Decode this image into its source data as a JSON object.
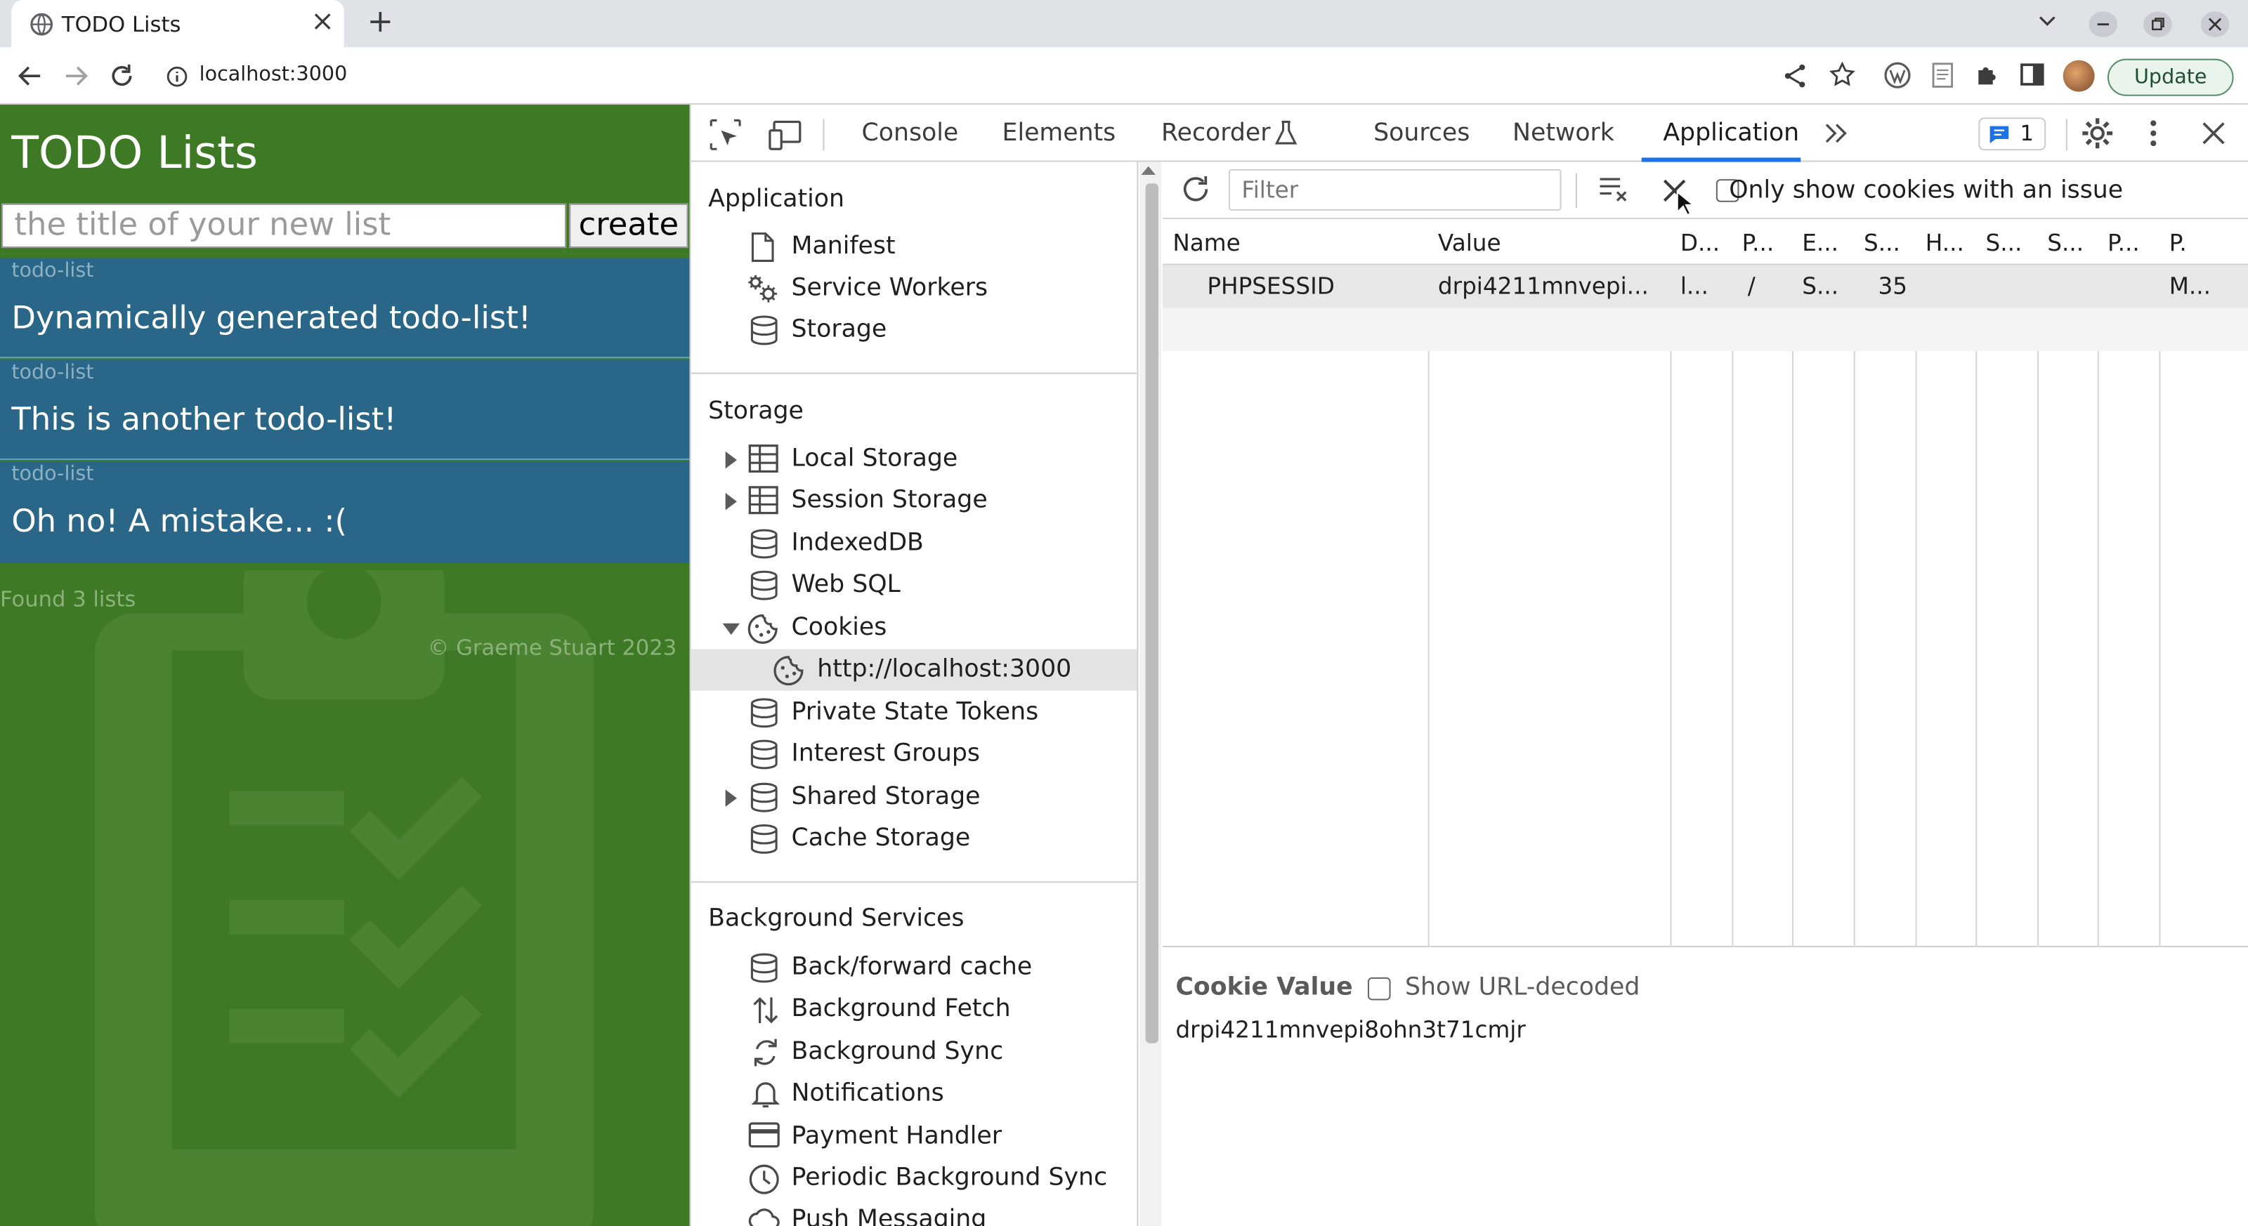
{
  "browser": {
    "tab_title": "TODO Lists",
    "new_tab": "+",
    "url": "localhost:3000",
    "update_label": "Update"
  },
  "page": {
    "title": "TODO Lists",
    "input_placeholder": "the title of your new list",
    "create_label": "create",
    "lists": [
      {
        "label": "todo-list",
        "text": "Dynamically generated todo-list!"
      },
      {
        "label": "todo-list",
        "text": "This is another todo-list!"
      },
      {
        "label": "todo-list",
        "text": "Oh no! A mistake... :("
      }
    ],
    "found": "Found 3 lists",
    "copyright": "© Graeme Stuart 2023"
  },
  "devtools": {
    "tabs": [
      "Console",
      "Elements",
      "Recorder",
      "Sources",
      "Network",
      "Application"
    ],
    "active_tab": "Application",
    "issues_count": "1",
    "sidebar": {
      "application_header": "Application",
      "application_items": [
        "Manifest",
        "Service Workers",
        "Storage"
      ],
      "storage_header": "Storage",
      "storage_items": [
        "Local Storage",
        "Session Storage",
        "IndexedDB",
        "Web SQL",
        "Cookies",
        "http://localhost:3000",
        "Private State Tokens",
        "Interest Groups",
        "Shared Storage",
        "Cache Storage"
      ],
      "background_header": "Background Services",
      "background_items": [
        "Back/forward cache",
        "Background Fetch",
        "Background Sync",
        "Notifications",
        "Payment Handler",
        "Periodic Background Sync",
        "Push Messaging"
      ]
    },
    "cookies": {
      "filter_placeholder": "Filter",
      "only_issue_label": "Only show cookies with an issue",
      "columns": [
        "Name",
        "Value",
        "D...",
        "P...",
        "E...",
        "S...",
        "H...",
        "S...",
        "S...",
        "P...",
        "P."
      ],
      "rows": [
        [
          "PHPSESSID",
          "drpi4211mnvepi...",
          "l...",
          "/",
          "S...",
          "35",
          "",
          "",
          "",
          "",
          "M..."
        ]
      ],
      "cookie_value_label": "Cookie Value",
      "show_decoded_label": "Show URL-decoded",
      "cookie_value": "drpi4211mnvepi8ohn3t71cmjr"
    }
  },
  "colors": {
    "page_green": "#3e7a25",
    "list_blue": "#2a6687",
    "accent": "#1a73e8"
  }
}
